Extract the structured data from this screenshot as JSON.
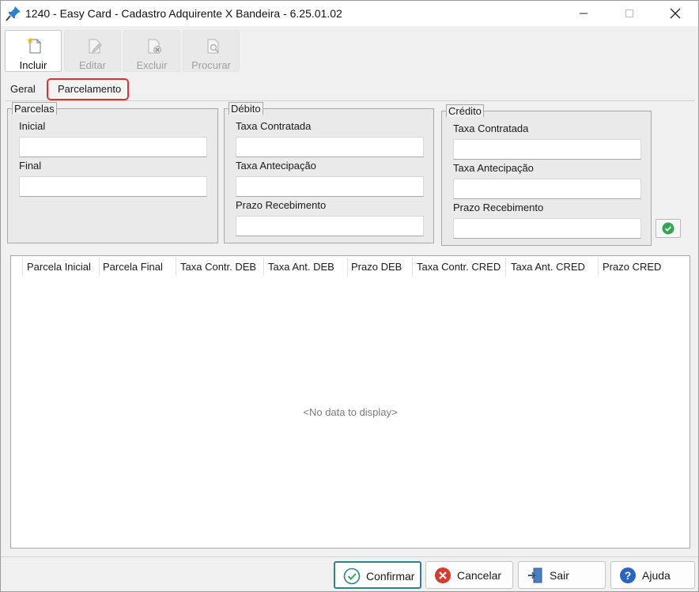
{
  "window": {
    "title": "1240 - Easy Card - Cadastro Adquirente X Bandeira - 6.25.01.02",
    "controls": {
      "minimize": "—",
      "maximize": "□",
      "close": "✕"
    }
  },
  "toolbar": {
    "incluir_label": "Incluir",
    "editar_label": "Editar",
    "excluir_label": "Excluir",
    "procurar_label": "Procurar"
  },
  "tabs": {
    "geral": "Geral",
    "parcelamento": "Parcelamento"
  },
  "parcelas": {
    "title": "Parcelas",
    "inicial_label": "Inicial",
    "inicial_value": "",
    "final_label": "Final",
    "final_value": ""
  },
  "debito": {
    "title": "Débito",
    "taxa_contratada_label": "Taxa Contratada",
    "taxa_contratada_value": "",
    "taxa_antecipacao_label": "Taxa Antecipação",
    "taxa_antecipacao_value": "",
    "prazo_recebimento_label": "Prazo Recebimento",
    "prazo_recebimento_value": ""
  },
  "credito": {
    "title": "Crédito",
    "taxa_contratada_label": "Taxa Contratada",
    "taxa_contratada_value": "",
    "taxa_antecipacao_label": "Taxa Antecipação",
    "taxa_antecipacao_value": "",
    "prazo_recebimento_label": "Prazo Recebimento",
    "prazo_recebimento_value": ""
  },
  "grid": {
    "columns": [
      "Parcela Inicial",
      "Parcela Final",
      "Taxa Contr. DEB",
      "Taxa Ant. DEB",
      "Prazo DEB",
      "Taxa Contr. CRED",
      "Taxa Ant. CRED",
      "Prazo CRED"
    ],
    "empty_text": "<No data to display>"
  },
  "buttons": {
    "confirmar": "Confirmar",
    "cancelar": "Cancelar",
    "sair": "Sair",
    "ajuda": "Ajuda"
  },
  "colors": {
    "accent_teal": "#2f7f92",
    "highlight_red": "#e03131",
    "ok_green": "#2fa84f",
    "cancel_red": "#d93a2f",
    "help_blue": "#2764c4"
  }
}
